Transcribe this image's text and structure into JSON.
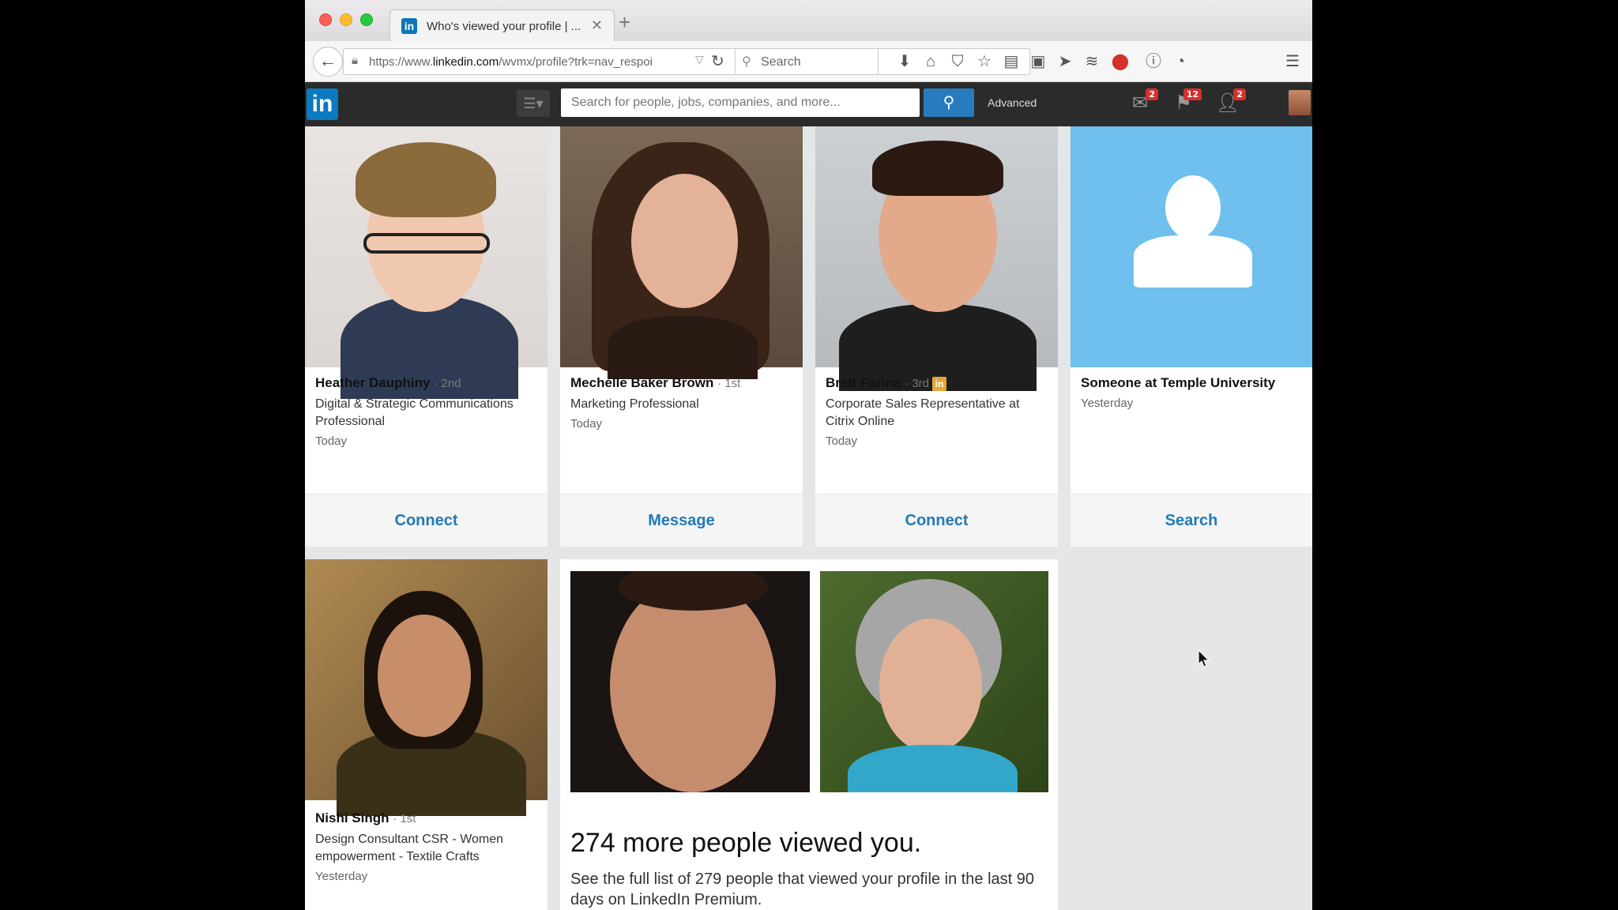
{
  "browser": {
    "tab_title": "Who's viewed your profile | ...",
    "tab_favicon": "in",
    "url_prefix": "https://www.",
    "url_domain": "linkedin.com",
    "url_path": "/wvmx/profile?trk=nav_respoi",
    "search_placeholder": "Search"
  },
  "linkedin_header": {
    "logo": "in",
    "search_placeholder": "Search for people, jobs, companies, and more...",
    "advanced_label": "Advanced",
    "messages_count": "2",
    "notifications_count": "12",
    "invitations_count": "2"
  },
  "viewers": [
    {
      "name": "Heather Dauphiny",
      "degree": "· 2nd",
      "title": "Digital & Strategic Communications Professional",
      "when": "Today",
      "action": "Connect"
    },
    {
      "name": "Mechelle Baker Brown",
      "degree": "· 1st",
      "title": "Marketing Professional",
      "when": "Today",
      "action": "Message"
    },
    {
      "name": "Brett Farina",
      "degree": "· 3rd",
      "title": "Corporate Sales Representative at Citrix Online",
      "when": "Today",
      "action": "Connect",
      "premium_badge": "in"
    },
    {
      "name": "Someone at Temple University",
      "degree": "",
      "title": "",
      "when": "Yesterday",
      "action": "Search"
    },
    {
      "name": "Nishi Singh",
      "degree": "· 1st",
      "title": "Design Consultant CSR - Women empowerment - Textile Crafts",
      "when": "Yesterday",
      "action": ""
    }
  ],
  "premium": {
    "headline": "274 more people viewed you.",
    "text": "See the full list of 279 people that viewed your profile in the last 90 days on LinkedIn Premium."
  },
  "colors": {
    "linkedin_blue": "#0b7bc1",
    "action_blue": "#227ab6",
    "anonymous_bg": "#6fc0ef",
    "badge_red": "#d5312c",
    "premium_gold": "#e6a735"
  }
}
